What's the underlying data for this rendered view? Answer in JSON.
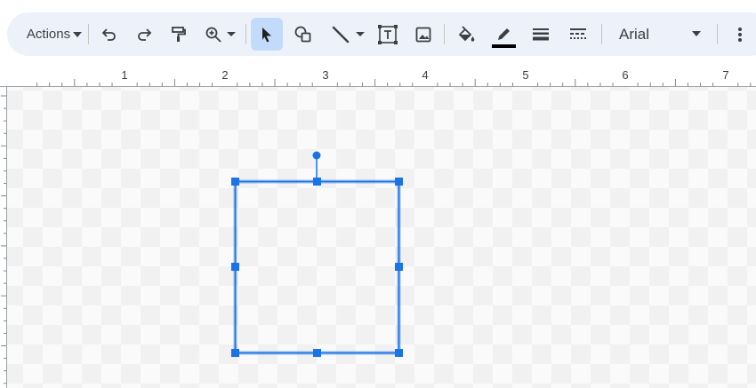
{
  "toolbar": {
    "actions_label": "Actions",
    "font_name": "Arial",
    "line_color": "#000000",
    "accent_color": "#1a73e8",
    "selected_tool": "select-icon"
  },
  "icons": [
    "chevron-down-icon",
    "undo-icon",
    "redo-icon",
    "paint-format-icon",
    "zoom-icon",
    "select-icon",
    "shape-icon",
    "line-icon",
    "text-box-icon",
    "image-icon",
    "fill-color-icon",
    "border-color-icon",
    "border-weight-icon",
    "border-dash-icon",
    "more-options-icon"
  ],
  "ruler": {
    "labels": [
      "1",
      "2",
      "3",
      "4",
      "5",
      "6",
      "7"
    ]
  },
  "canvas": {
    "shape": "rectangle",
    "selected": true
  }
}
